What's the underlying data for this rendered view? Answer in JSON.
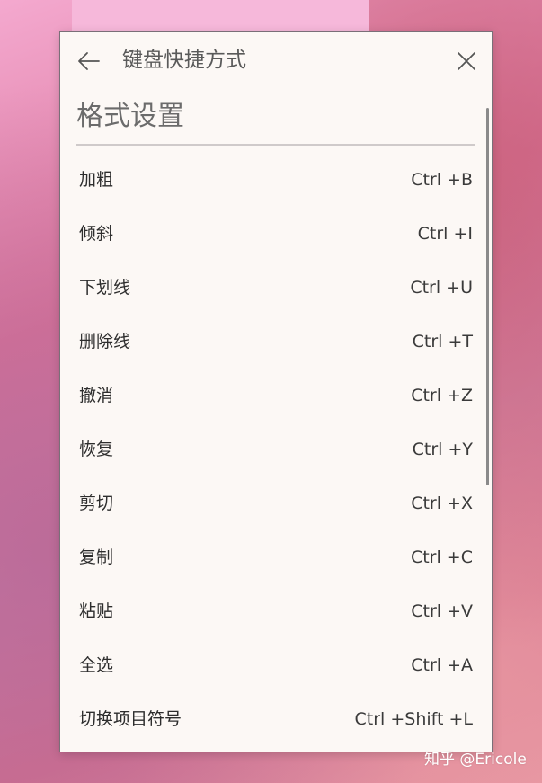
{
  "header": {
    "title": "键盘快捷方式"
  },
  "section": {
    "title": "格式设置"
  },
  "shortcuts": [
    {
      "label": "加粗",
      "keys": "Ctrl +B"
    },
    {
      "label": "倾斜",
      "keys": "Ctrl +I"
    },
    {
      "label": "下划线",
      "keys": "Ctrl +U"
    },
    {
      "label": "删除线",
      "keys": "Ctrl +T"
    },
    {
      "label": "撤消",
      "keys": "Ctrl +Z"
    },
    {
      "label": "恢复",
      "keys": "Ctrl +Y"
    },
    {
      "label": "剪切",
      "keys": "Ctrl +X"
    },
    {
      "label": "复制",
      "keys": "Ctrl +C"
    },
    {
      "label": "粘贴",
      "keys": "Ctrl +V"
    },
    {
      "label": "全选",
      "keys": "Ctrl +A"
    },
    {
      "label": "切换项目符号",
      "keys": "Ctrl +Shift +L"
    }
  ],
  "watermark": "知乎 @Ericole",
  "icons": {
    "back": "arrow-left-icon",
    "close": "close-icon"
  },
  "colors": {
    "panel_bg": "#fcf8f5",
    "text": "#2d2d2d",
    "title": "#5a5a5a"
  }
}
